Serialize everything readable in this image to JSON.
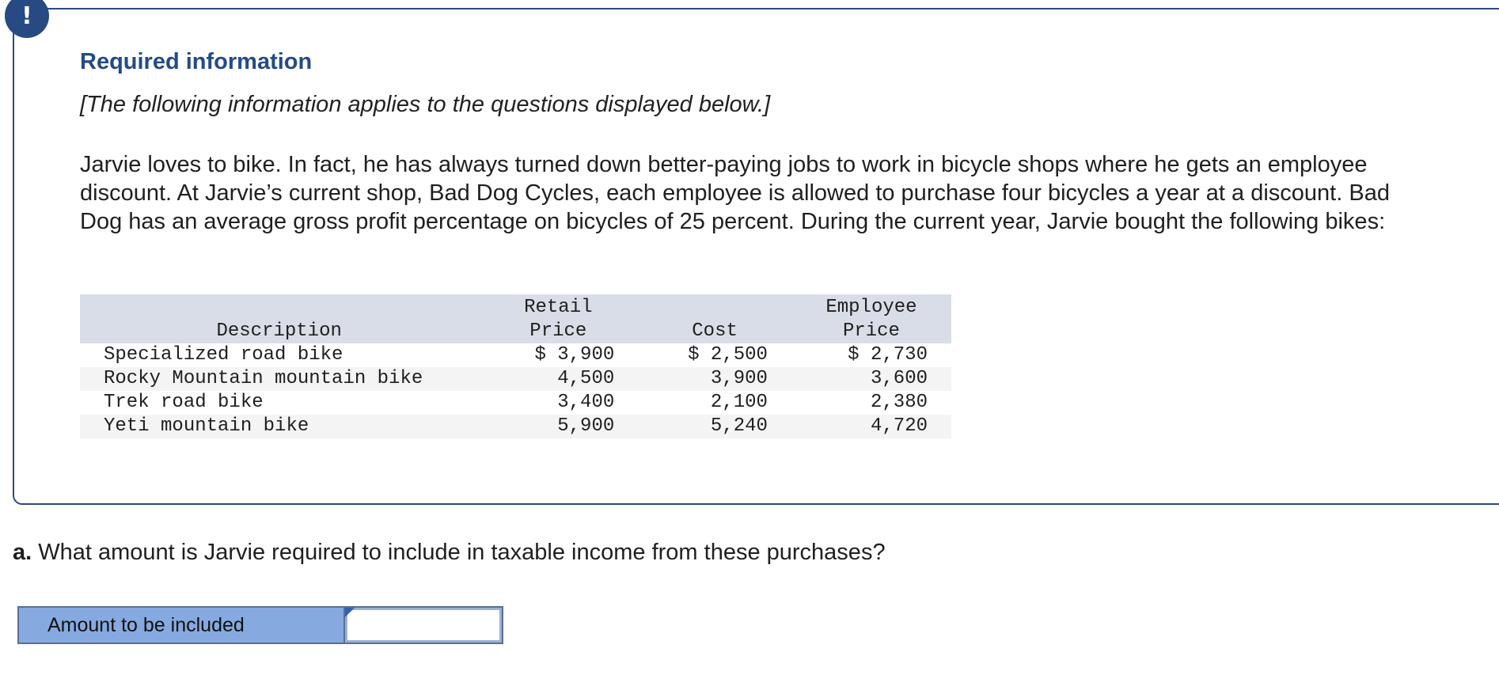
{
  "info": {
    "badge_icon": "!",
    "title": "Required information",
    "note": "[The following information applies to the questions displayed below.]",
    "paragraph": "Jarvie loves to bike. In fact, he has always turned down better-paying jobs to work in bicycle shops where he gets an employee discount. At Jarvie’s current shop, Bad Dog Cycles, each employee is allowed to purchase four bicycles a year at a discount. Bad Dog has an average gross profit percentage on bicycles of 25 percent. During the current year, Jarvie bought the following bikes:"
  },
  "table": {
    "headers": {
      "description": "Description",
      "retail": "Retail Price",
      "cost": "Cost",
      "employee_line1": "Employee",
      "employee_line2": "Price"
    },
    "rows": [
      {
        "description": "Specialized road bike",
        "retail": "$ 3,900",
        "cost": "$ 2,500",
        "employee": "$ 2,730"
      },
      {
        "description": "Rocky Mountain mountain bike",
        "retail": "4,500",
        "cost": "3,900",
        "employee": "3,600"
      },
      {
        "description": "Trek road bike",
        "retail": "3,400",
        "cost": "2,100",
        "employee": "2,380"
      },
      {
        "description": "Yeti mountain bike",
        "retail": "5,900",
        "cost": "5,240",
        "employee": "4,720"
      }
    ]
  },
  "question": {
    "letter": "a.",
    "text": " What amount is Jarvie required to include in taxable income from these purchases?"
  },
  "answer": {
    "label": "Amount to be included",
    "value": ""
  },
  "colors": {
    "accent": "#244b84",
    "label_fill": "#86a9e0",
    "header_fill": "#d9dde7"
  }
}
